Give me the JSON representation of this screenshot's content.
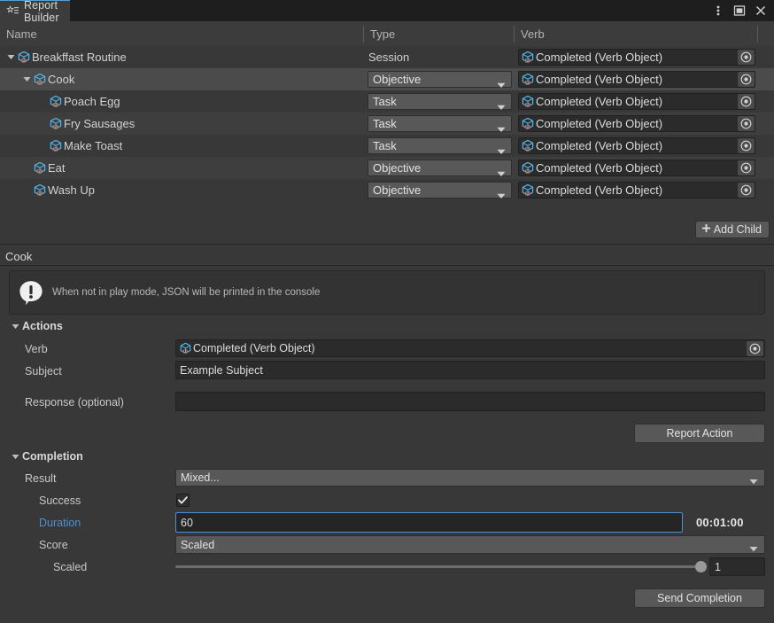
{
  "window": {
    "tab_label": "Report Builder",
    "tab_icon": "star-list-icon",
    "menu_icon": "kebab-menu-icon",
    "maximize_icon": "maximize-icon",
    "close_icon": "close-icon"
  },
  "tree": {
    "columns": [
      "Name",
      "Type",
      "Verb"
    ],
    "rows": [
      {
        "name": "Breakffast Routine",
        "indent": 0,
        "expanded": true,
        "has_twisty": true,
        "type": "Session",
        "type_is_popup": false,
        "verb": "Completed (Verb Object)",
        "selected": false
      },
      {
        "name": "Cook",
        "indent": 1,
        "expanded": true,
        "has_twisty": true,
        "type": "Objective",
        "type_is_popup": true,
        "verb": "Completed (Verb Object)",
        "selected": true
      },
      {
        "name": "Poach Egg",
        "indent": 2,
        "expanded": false,
        "has_twisty": false,
        "type": "Task",
        "type_is_popup": true,
        "verb": "Completed (Verb Object)",
        "selected": false
      },
      {
        "name": "Fry Sausages",
        "indent": 2,
        "expanded": false,
        "has_twisty": false,
        "type": "Task",
        "type_is_popup": true,
        "verb": "Completed (Verb Object)",
        "selected": false
      },
      {
        "name": "Make Toast",
        "indent": 2,
        "expanded": false,
        "has_twisty": false,
        "type": "Task",
        "type_is_popup": true,
        "verb": "Completed (Verb Object)",
        "selected": false
      },
      {
        "name": "Eat",
        "indent": 1,
        "expanded": false,
        "has_twisty": false,
        "type": "Objective",
        "type_is_popup": true,
        "verb": "Completed (Verb Object)",
        "selected": false
      },
      {
        "name": "Wash Up",
        "indent": 1,
        "expanded": false,
        "has_twisty": false,
        "type": "Objective",
        "type_is_popup": true,
        "verb": "Completed (Verb Object)",
        "selected": false
      }
    ],
    "add_child_label": "Add Child",
    "add_child_icon": "plus-icon"
  },
  "detail": {
    "title": "Cook",
    "help_icon": "info-bubble-icon",
    "help_text": "When not in play mode, JSON will be printed in the console"
  },
  "actions": {
    "section_label": "Actions",
    "verb_label": "Verb",
    "verb_value": "Completed (Verb Object)",
    "verb_picker_icon": "object-picker-icon",
    "subject_label": "Subject",
    "subject_value": "Example Subject",
    "response_label": "Response (optional)",
    "response_value": "",
    "report_button": "Report Action"
  },
  "completion": {
    "section_label": "Completion",
    "result_label": "Result",
    "result_value": "Mixed...",
    "success_label": "Success",
    "success_checked": true,
    "check_icon": "checkmark-icon",
    "duration_label": "Duration",
    "duration_value": "60",
    "duration_display": "00:01:00",
    "score_label": "Score",
    "score_value": "Scaled",
    "scaled_label": "Scaled",
    "scaled_value": "1",
    "scaled_slider_fraction": 1.0,
    "send_button": "Send Completion"
  },
  "colors": {
    "background": "#383838",
    "titlebar": "#1e1e1e",
    "tab_accent": "#5a9fd4",
    "selection": "#4b4b4b",
    "active_label": "#4f8fd6",
    "field_bg": "#2b2b2b",
    "popup_bg": "#585858",
    "so_icon_blue": "#4fb3e8",
    "so_icon_orange": "#e2683c"
  }
}
